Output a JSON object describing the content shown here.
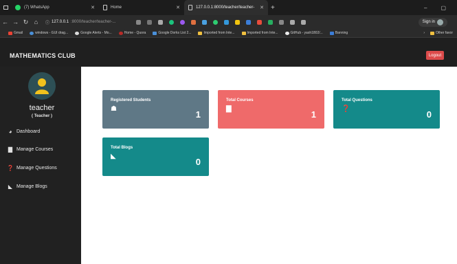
{
  "browser": {
    "tabs": [
      {
        "label": "(7) WhatsApp"
      },
      {
        "label": "Home"
      },
      {
        "label": "127.0.0.1:8000/teacher/teacher-"
      }
    ],
    "url_host": "127.0.0.1",
    "url_path": ":8000/teacher/teacher-...",
    "signin_label": "Sign in",
    "bookmarks": [
      "Gmail",
      "windows - GUI drag...",
      "Google Alerts - Mo...",
      "Home - Quora",
      "Google Dorks List 2...",
      "Imported from Inte...",
      "Imported from Inte...",
      "GitHub - yash1802/...",
      "Banning"
    ],
    "bookmark_other": "Other favor"
  },
  "app": {
    "brand": "MATHEMATICS CLUB",
    "logout_label": "Logout",
    "user": {
      "name": "teacher",
      "role": "( Teacher )"
    },
    "menu": [
      {
        "label": "Dashboard",
        "icon": "dashboard-icon"
      },
      {
        "label": "Manage Courses",
        "icon": "book-icon"
      },
      {
        "label": "Manage Questions",
        "icon": "question-icon"
      },
      {
        "label": "Manage Blogs",
        "icon": "blog-icon"
      }
    ],
    "cards": [
      {
        "title": "Registered Students",
        "value": "1",
        "color": "#5f7886",
        "icon": "student-icon"
      },
      {
        "title": "Total Courses",
        "value": "1",
        "color": "#ef6a6a",
        "icon": "book-icon"
      },
      {
        "title": "Total Questions",
        "value": "0",
        "color": "#148a8a",
        "icon": "question-icon"
      },
      {
        "title": "Total Blogs",
        "value": "0",
        "color": "#148a8a",
        "icon": "rss-icon"
      }
    ]
  }
}
